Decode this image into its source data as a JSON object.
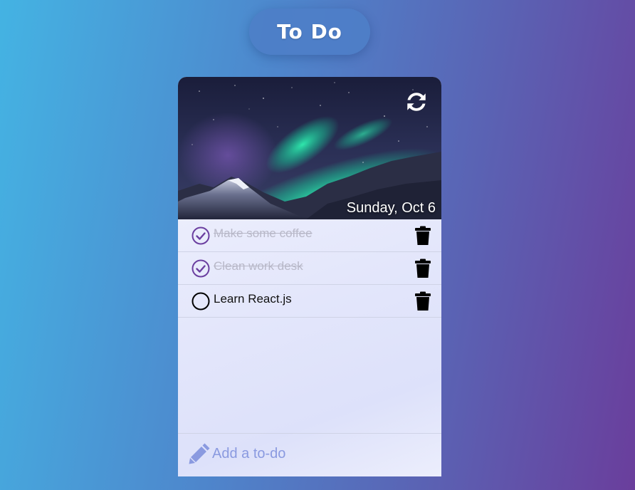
{
  "header": {
    "title": "To Do"
  },
  "card": {
    "date": "Sunday, Oct 6",
    "refresh_icon": "refresh-icon"
  },
  "todos": [
    {
      "text": "Make some coffee",
      "completed": true
    },
    {
      "text": "Clean work desk",
      "completed": true
    },
    {
      "text": "Learn React.js",
      "completed": false
    }
  ],
  "add": {
    "placeholder": "Add a to-do",
    "icon": "pencil-icon"
  },
  "colors": {
    "accent_purple": "#6b3fa0",
    "add_hint": "#8a9ae0",
    "done_text": "#b8b8c8"
  }
}
